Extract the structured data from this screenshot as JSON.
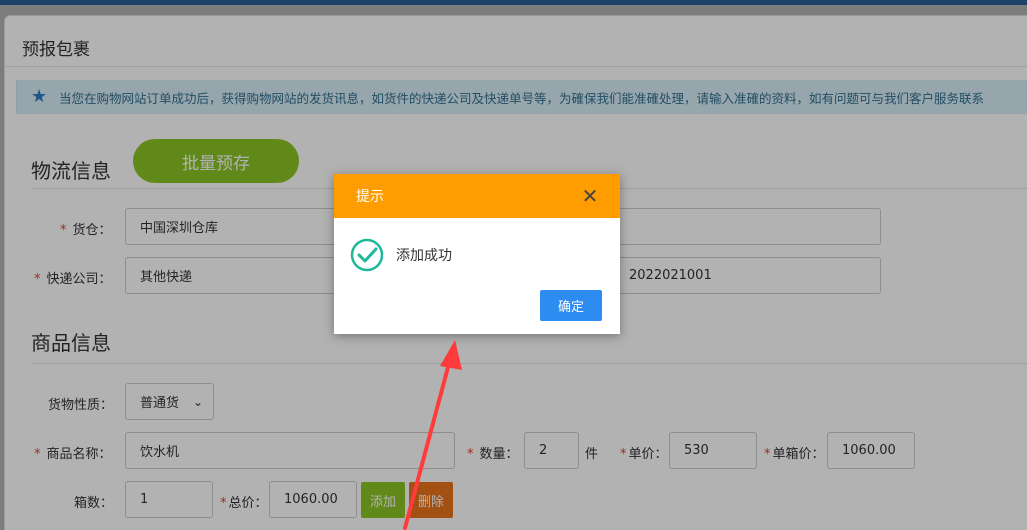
{
  "page": {
    "title": "预报包裹"
  },
  "notice": {
    "text": "当您在购物网站订单成功后，获得购物网站的发货讯息，如货件的快递公司及快递单号等，为確保我们能准確处理，请输入准確的资料，如有问题可与我们客户服务联系"
  },
  "logistics": {
    "section_title": "物流信息",
    "batch_button": "批量预存",
    "warehouse_label": "货仓：",
    "warehouse_value": "中国深圳仓库",
    "courier_label": "快递公司：",
    "courier_value": "其他快递",
    "tracking_value": "2022021001"
  },
  "goods": {
    "section_title": "商品信息",
    "nature_label": "货物性质：",
    "nature_value": "普通货",
    "name_label": "商品名称：",
    "name_value": "饮水机",
    "qty_label": "数量：",
    "qty_value": "2",
    "qty_unit": "件",
    "price_label": "单价：",
    "price_value": "530",
    "box_price_label": "单箱价：",
    "box_price_value": "1060.00",
    "boxes_label": "箱数：",
    "boxes_value": "1",
    "total_label": "总价：",
    "total_value": "1060.00",
    "add_button": "添加",
    "delete_button": "删除"
  },
  "dialog": {
    "title": "提示",
    "message": "添加成功",
    "ok_button": "确定"
  },
  "colors": {
    "dialog_header": "#ff9c00",
    "ok_button": "#2d8cf0",
    "green": "#8cc425",
    "orange": "#e8741c",
    "arrow": "#ff3b3b"
  }
}
